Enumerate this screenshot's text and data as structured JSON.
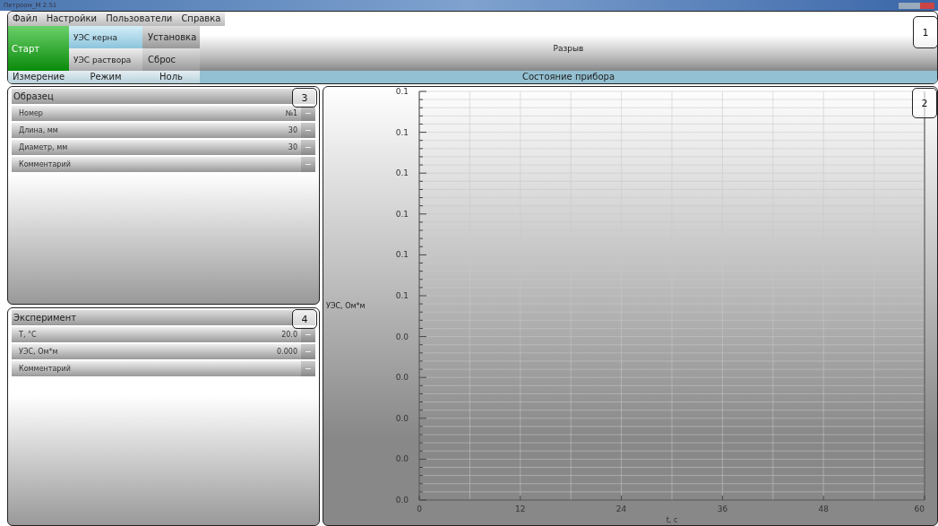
{
  "window": {
    "title": "Петроом_M 2.51"
  },
  "menu": [
    {
      "label": "Файл"
    },
    {
      "label": "Настройки"
    },
    {
      "label": "Пользователи"
    },
    {
      "label": "Справка"
    }
  ],
  "toolbar": {
    "start": "Старт",
    "modes": [
      {
        "label": "УЭС керна",
        "selected": true
      },
      {
        "label": "УЭС раствора",
        "selected": false
      }
    ],
    "zero": [
      "Установка",
      "Сброс"
    ],
    "status": "Разрыв"
  },
  "group_labels": [
    "Измерение",
    "Режим",
    "Ноль",
    "Состояние прибора"
  ],
  "panels": [
    {
      "title": "Образец",
      "callout": "3",
      "rows": [
        {
          "label": "Номер",
          "value": "№1"
        },
        {
          "label": "Длина, мм",
          "value": "30"
        },
        {
          "label": "Диаметр, мм",
          "value": "30"
        },
        {
          "label": "Комментарий"
        }
      ]
    },
    {
      "title": "Эксперимент",
      "callout": "4",
      "rows": [
        {
          "label": "T, °C",
          "value": "20.0"
        },
        {
          "label": "УЭС, Ом*м",
          "value": "0.000"
        },
        {
          "label": "Комментарий"
        }
      ]
    }
  ],
  "callouts": [
    "1",
    "2"
  ],
  "chart": {
    "chart_data": {
      "type": "line",
      "grid": true,
      "xlabel": "t, c",
      "ylabel": "УЭС, Ом*м",
      "xlim": [
        0,
        60
      ],
      "ylim": [
        0,
        0.1
      ],
      "xticks": [
        0,
        12,
        24,
        36,
        48,
        60
      ],
      "yticks": [
        {
          "value": 0,
          "label": "0.0"
        },
        {
          "value": 0.01,
          "label": "0.0"
        },
        {
          "value": 0.02,
          "label": "0.0"
        },
        {
          "value": 0.03,
          "label": "0.0"
        },
        {
          "value": 0.04,
          "label": "0.0"
        },
        {
          "value": 0.05,
          "label": "0.1"
        },
        {
          "value": 0.06,
          "label": "0.1"
        },
        {
          "value": 0.07,
          "label": "0.1"
        },
        {
          "value": 0.08,
          "label": "0.1"
        },
        {
          "value": 0.09,
          "label": "0.1"
        },
        {
          "value": 0.1,
          "label": "0.1"
        }
      ]
    }
  }
}
